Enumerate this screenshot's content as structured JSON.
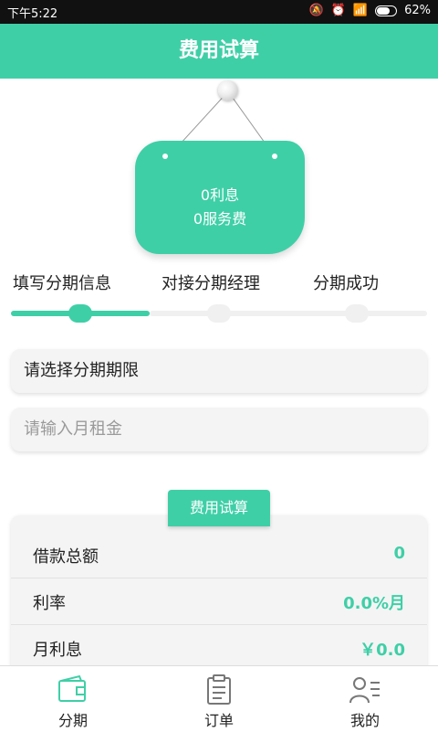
{
  "status_bar": {
    "time": "下午5:22",
    "battery": "62%"
  },
  "header": {
    "title": "费用试算"
  },
  "sign": {
    "line1": "0利息",
    "line2": "0服务费"
  },
  "steps": [
    "填写分期信息",
    "对接分期经理",
    "分期成功"
  ],
  "progress": {
    "current_step": 1,
    "total_steps": 3
  },
  "form": {
    "period_select": "请选择分期期限",
    "rent_input_placeholder": "请输入月租金"
  },
  "calc": {
    "tab_label": "费用试算",
    "rows": [
      {
        "label": "借款总额",
        "value": "0"
      },
      {
        "label": "利率",
        "value": "0.0%月"
      },
      {
        "label": "月利息",
        "value": "￥0.0"
      }
    ]
  },
  "tabbar": [
    {
      "label": "分期",
      "icon": "wallet-icon"
    },
    {
      "label": "订单",
      "icon": "clipboard-icon"
    },
    {
      "label": "我的",
      "icon": "user-list-icon"
    }
  ],
  "colors": {
    "accent": "#3fcfa7",
    "status_bar": "#111111"
  }
}
